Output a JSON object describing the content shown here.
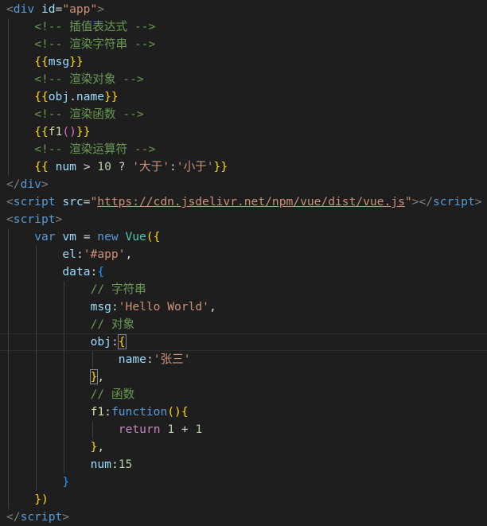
{
  "colors": {
    "background": "#1e1e1e",
    "tag": "#569cd6",
    "attribute": "#9cdcfe",
    "string": "#ce9178",
    "comment": "#6a9955",
    "number": "#b5cea8",
    "function": "#dcdcaa",
    "class": "#4ec9b0",
    "keyword_control": "#c586c0",
    "bracket_level1": "#ffd700",
    "bracket_level2": "#da70d6",
    "bracket_level3": "#179fff"
  },
  "lines": [
    {
      "indent": 0,
      "tokens": [
        {
          "c": "tag-br",
          "v": "<"
        },
        {
          "c": "tag",
          "v": "div"
        },
        {
          "c": "plain",
          "v": " "
        },
        {
          "c": "attr",
          "v": "id"
        },
        {
          "c": "plain",
          "v": "="
        },
        {
          "c": "str",
          "v": "\"app\""
        },
        {
          "c": "tag-br",
          "v": ">"
        }
      ]
    },
    {
      "indent": 1,
      "tokens": [
        {
          "c": "comment",
          "v": "<!-- 插值表达式 -->"
        }
      ]
    },
    {
      "indent": 1,
      "tokens": [
        {
          "c": "comment",
          "v": "<!-- 渲染字符串 -->"
        }
      ]
    },
    {
      "indent": 1,
      "tokens": [
        {
          "c": "mustache",
          "v": "{{"
        },
        {
          "c": "var",
          "v": "msg"
        },
        {
          "c": "mustache",
          "v": "}}"
        }
      ]
    },
    {
      "indent": 1,
      "tokens": [
        {
          "c": "comment",
          "v": "<!-- 渲染对象 -->"
        }
      ]
    },
    {
      "indent": 1,
      "tokens": [
        {
          "c": "mustache",
          "v": "{{"
        },
        {
          "c": "var",
          "v": "obj"
        },
        {
          "c": "plain",
          "v": "."
        },
        {
          "c": "var",
          "v": "name"
        },
        {
          "c": "mustache",
          "v": "}}"
        }
      ]
    },
    {
      "indent": 1,
      "tokens": [
        {
          "c": "comment",
          "v": "<!-- 渲染函数 -->"
        }
      ]
    },
    {
      "indent": 1,
      "tokens": [
        {
          "c": "mustache",
          "v": "{{"
        },
        {
          "c": "fn",
          "v": "f1"
        },
        {
          "c": "b2",
          "v": "()"
        },
        {
          "c": "mustache",
          "v": "}}"
        }
      ]
    },
    {
      "indent": 1,
      "tokens": [
        {
          "c": "comment",
          "v": "<!-- 渲染运算符 -->"
        }
      ]
    },
    {
      "indent": 1,
      "tokens": [
        {
          "c": "mustache",
          "v": "{{"
        },
        {
          "c": "plain",
          "v": " "
        },
        {
          "c": "var",
          "v": "num"
        },
        {
          "c": "plain",
          "v": " > "
        },
        {
          "c": "num",
          "v": "10"
        },
        {
          "c": "plain",
          "v": " ? "
        },
        {
          "c": "str",
          "v": "'大于'"
        },
        {
          "c": "plain",
          "v": ":"
        },
        {
          "c": "str",
          "v": "'小于'"
        },
        {
          "c": "mustache",
          "v": "}}"
        }
      ]
    },
    {
      "indent": 0,
      "tokens": [
        {
          "c": "tag-br",
          "v": "</"
        },
        {
          "c": "tag",
          "v": "div"
        },
        {
          "c": "tag-br",
          "v": ">"
        }
      ]
    },
    {
      "indent": 0,
      "tokens": [
        {
          "c": "tag-br",
          "v": "<"
        },
        {
          "c": "tag",
          "v": "script"
        },
        {
          "c": "plain",
          "v": " "
        },
        {
          "c": "attr",
          "v": "src"
        },
        {
          "c": "plain",
          "v": "="
        },
        {
          "c": "str",
          "v": "\""
        },
        {
          "c": "url",
          "v": "https://cdn.jsdelivr.net/npm/vue/dist/vue.js"
        },
        {
          "c": "str",
          "v": "\""
        },
        {
          "c": "tag-br",
          "v": "></"
        },
        {
          "c": "tag",
          "v": "script"
        },
        {
          "c": "tag-br",
          "v": ">"
        }
      ]
    },
    {
      "indent": 0,
      "tokens": [
        {
          "c": "tag-br",
          "v": "<"
        },
        {
          "c": "tag",
          "v": "script"
        },
        {
          "c": "tag-br",
          "v": ">"
        }
      ]
    },
    {
      "indent": 1,
      "tokens": [
        {
          "c": "kw",
          "v": "var"
        },
        {
          "c": "plain",
          "v": " "
        },
        {
          "c": "var",
          "v": "vm"
        },
        {
          "c": "plain",
          "v": " = "
        },
        {
          "c": "kw",
          "v": "new"
        },
        {
          "c": "plain",
          "v": " "
        },
        {
          "c": "cls",
          "v": "Vue"
        },
        {
          "c": "b1",
          "v": "({"
        }
      ]
    },
    {
      "indent": 2,
      "tokens": [
        {
          "c": "var",
          "v": "el"
        },
        {
          "c": "plain",
          "v": ":"
        },
        {
          "c": "str",
          "v": "'#app'"
        },
        {
          "c": "plain",
          "v": ","
        }
      ]
    },
    {
      "indent": 2,
      "tokens": [
        {
          "c": "var",
          "v": "data"
        },
        {
          "c": "plain",
          "v": ":"
        },
        {
          "c": "b3",
          "v": "{"
        }
      ]
    },
    {
      "indent": 3,
      "tokens": [
        {
          "c": "comment",
          "v": "// 字符串"
        }
      ]
    },
    {
      "indent": 3,
      "tokens": [
        {
          "c": "var",
          "v": "msg"
        },
        {
          "c": "plain",
          "v": ":"
        },
        {
          "c": "str",
          "v": "'Hello World'"
        },
        {
          "c": "plain",
          "v": ","
        }
      ]
    },
    {
      "indent": 3,
      "tokens": [
        {
          "c": "comment",
          "v": "// 对象"
        }
      ]
    },
    {
      "indent": 3,
      "current": true,
      "tokens": [
        {
          "c": "var",
          "v": "obj"
        },
        {
          "c": "plain",
          "v": ":"
        },
        {
          "c": "b1",
          "v": "{",
          "box": true
        }
      ]
    },
    {
      "indent": 4,
      "tokens": [
        {
          "c": "var",
          "v": "name"
        },
        {
          "c": "plain",
          "v": ":"
        },
        {
          "c": "str",
          "v": "'张三'"
        }
      ]
    },
    {
      "indent": 3,
      "tokens": [
        {
          "c": "b1",
          "v": "}",
          "box": true
        },
        {
          "c": "plain",
          "v": ","
        }
      ]
    },
    {
      "indent": 3,
      "tokens": [
        {
          "c": "comment",
          "v": "// 函数"
        }
      ]
    },
    {
      "indent": 3,
      "tokens": [
        {
          "c": "fn",
          "v": "f1"
        },
        {
          "c": "plain",
          "v": ":"
        },
        {
          "c": "kw",
          "v": "function"
        },
        {
          "c": "b1",
          "v": "(){"
        }
      ]
    },
    {
      "indent": 4,
      "tokens": [
        {
          "c": "kw2",
          "v": "return"
        },
        {
          "c": "plain",
          "v": " "
        },
        {
          "c": "num",
          "v": "1"
        },
        {
          "c": "plain",
          "v": " + "
        },
        {
          "c": "num",
          "v": "1"
        }
      ]
    },
    {
      "indent": 3,
      "tokens": [
        {
          "c": "b1",
          "v": "}"
        },
        {
          "c": "plain",
          "v": ","
        }
      ]
    },
    {
      "indent": 3,
      "tokens": [
        {
          "c": "var",
          "v": "num"
        },
        {
          "c": "plain",
          "v": ":"
        },
        {
          "c": "num",
          "v": "15"
        }
      ]
    },
    {
      "indent": 2,
      "tokens": [
        {
          "c": "b3",
          "v": "}"
        }
      ]
    },
    {
      "indent": 1,
      "tokens": [
        {
          "c": "b1",
          "v": "})"
        }
      ]
    },
    {
      "indent": 0,
      "tokens": [
        {
          "c": "tag-br",
          "v": "</"
        },
        {
          "c": "tag",
          "v": "script"
        },
        {
          "c": "tag-br",
          "v": ">"
        }
      ]
    }
  ]
}
